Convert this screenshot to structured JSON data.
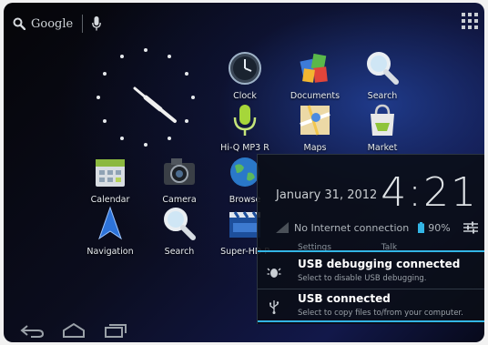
{
  "search": {
    "provider_label": "Google",
    "icon": "search-icon",
    "voice_icon": "mic-icon"
  },
  "apps_button": {
    "icon": "all-apps-icon"
  },
  "clock_widget": {
    "type": "analog-clock",
    "icon": "analog-clock-icon"
  },
  "apps": [
    {
      "label": "Clock",
      "icon": "clock-icon"
    },
    {
      "label": "Documents",
      "icon": "documents-icon"
    },
    {
      "label": "Search",
      "icon": "search-app-icon"
    },
    {
      "label": "Hi-Q MP3 R",
      "icon": "microphone-icon"
    },
    {
      "label": "Maps",
      "icon": "maps-icon"
    },
    {
      "label": "Market",
      "icon": "market-bag-icon"
    },
    {
      "label": "Calendar",
      "icon": "calendar-icon"
    },
    {
      "label": "Camera",
      "icon": "camera-icon"
    },
    {
      "label": "Browse",
      "icon": "globe-icon"
    },
    {
      "label": "Navigation",
      "icon": "navigation-arrow-icon"
    },
    {
      "label": "Search",
      "icon": "search-app-icon"
    },
    {
      "label": "Super-HD P",
      "icon": "clapper-icon"
    }
  ],
  "notification_panel": {
    "date": "January 31, 2012",
    "time": "4:21",
    "connection_status": "No Internet connection",
    "battery": "90%",
    "tabs": [
      "Settings",
      "Talk"
    ],
    "notifications": [
      {
        "title": "USB debugging connected",
        "subtitle": "Select to disable USB debugging.",
        "icon": "debug-bug-icon"
      },
      {
        "title": "USB connected",
        "subtitle": "Select to copy files to/from your computer.",
        "icon": "usb-icon"
      }
    ]
  },
  "navbar": {
    "back_icon": "back-icon",
    "home_icon": "home-icon",
    "recents_icon": "recent-apps-icon"
  },
  "colors": {
    "accent": "#33b5e5",
    "background": "#0b0d1e"
  }
}
